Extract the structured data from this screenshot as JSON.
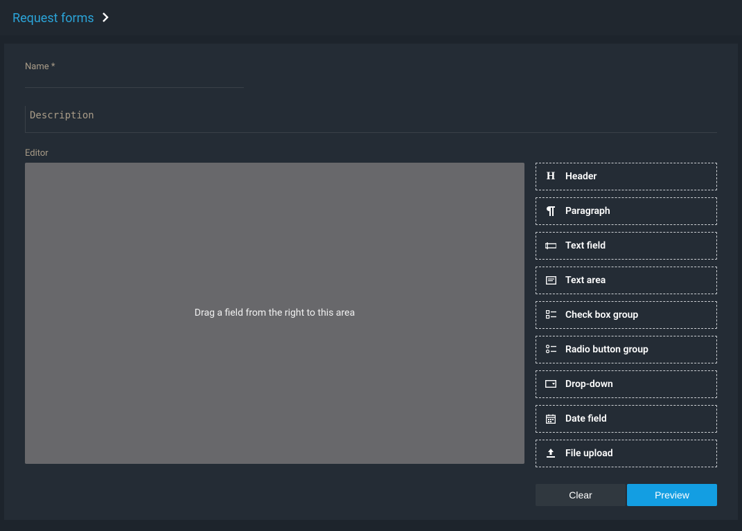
{
  "breadcrumb": {
    "root": "Request forms"
  },
  "fields": {
    "name_label": "Name *",
    "name_value": "",
    "description_placeholder": "Description",
    "description_value": ""
  },
  "editor": {
    "label": "Editor",
    "drop_hint": "Drag a field from the right to this area"
  },
  "palette": [
    {
      "icon": "header-icon",
      "label": "Header"
    },
    {
      "icon": "paragraph-icon",
      "label": "Paragraph"
    },
    {
      "icon": "text-field-icon",
      "label": "Text field"
    },
    {
      "icon": "text-area-icon",
      "label": "Text area"
    },
    {
      "icon": "checkbox-icon",
      "label": "Check box group"
    },
    {
      "icon": "radio-icon",
      "label": "Radio button group"
    },
    {
      "icon": "dropdown-icon",
      "label": "Drop-down"
    },
    {
      "icon": "date-icon",
      "label": "Date field"
    },
    {
      "icon": "upload-icon",
      "label": "File upload"
    }
  ],
  "actions": {
    "clear": "Clear",
    "preview": "Preview"
  }
}
